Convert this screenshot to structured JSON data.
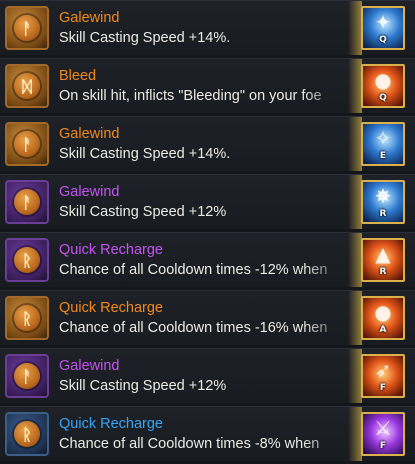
{
  "colors": {
    "orange": "#f08a1c",
    "purple": "#c454f0",
    "blue": "#38a4f4",
    "description": "#eceae4",
    "background": "#13161b"
  },
  "runes": [
    {
      "rarity": "orange",
      "glyph": "ᚨ",
      "title": "Galewind",
      "description": "Skill Casting Speed +14%.",
      "skill_icon": "wind-blade-skill-icon",
      "skill_key": "Q",
      "skill_tone": "blue"
    },
    {
      "rarity": "orange",
      "glyph": "ᛞ",
      "title": "Bleed",
      "description": "On skill hit, inflicts \"Bleeding\" on your foe",
      "skill_icon": "grenade-launcher-skill-icon",
      "skill_key": "Q",
      "skill_tone": "fire"
    },
    {
      "rarity": "orange",
      "glyph": "ᚨ",
      "title": "Galewind",
      "description": "Skill Casting Speed +14%.",
      "skill_icon": "gunslinger-skill-icon",
      "skill_key": "E",
      "skill_tone": "blue"
    },
    {
      "rarity": "purple",
      "glyph": "ᚨ",
      "title": "Galewind",
      "description": "Skill Casting Speed +12%",
      "skill_icon": "energy-burst-skill-icon",
      "skill_key": "R",
      "skill_tone": "blue"
    },
    {
      "rarity": "purple",
      "glyph": "ᚱ",
      "title": "Quick Recharge",
      "description": "Chance of all Cooldown times -12% when",
      "skill_icon": "turret-skill-icon",
      "skill_key": "R",
      "skill_tone": "fire"
    },
    {
      "rarity": "orange",
      "glyph": "ᚱ",
      "title": "Quick Recharge",
      "description": "Chance of all Cooldown times -16% when",
      "skill_icon": "bomb-skill-icon",
      "skill_key": "A",
      "skill_tone": "fire"
    },
    {
      "rarity": "purple",
      "glyph": "ᚨ",
      "title": "Galewind",
      "description": "Skill Casting Speed +12%",
      "skill_icon": "missile-skill-icon",
      "skill_key": "F",
      "skill_tone": "fire"
    },
    {
      "rarity": "blue",
      "glyph": "ᚱ",
      "title": "Quick Recharge",
      "description": "Chance of all Cooldown times -8% when",
      "skill_icon": "slash-skill-icon",
      "skill_key": "F",
      "skill_tone": "violet"
    }
  ]
}
